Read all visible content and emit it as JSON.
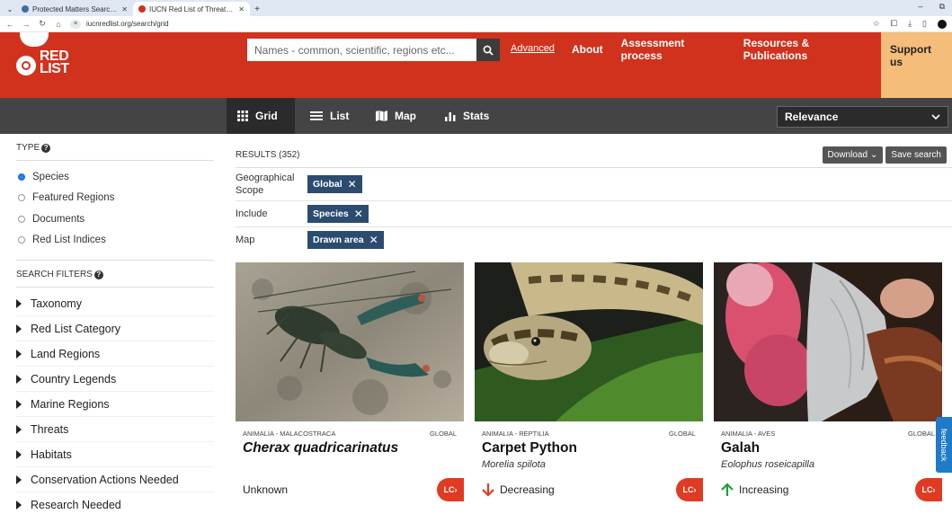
{
  "browser": {
    "tabs": [
      {
        "label": "Protected Matters Search Tool",
        "active": false,
        "favicon_color": "#3a6ea5"
      },
      {
        "label": "IUCN Red List of Threatened S",
        "active": true,
        "favicon_color": "#d0321d"
      }
    ],
    "url": "iucnredlist.org/search/grid"
  },
  "header": {
    "logo_text": "RED\nLIST",
    "search_placeholder": "Names - common, scientific, regions etc...",
    "advanced_link": "Advanced",
    "nav": [
      "About",
      "Assessment process",
      "Resources & Publications",
      "Support us"
    ]
  },
  "viewbar": {
    "tabs": [
      {
        "label": "Grid",
        "icon": "grid-icon",
        "active": true
      },
      {
        "label": "List",
        "icon": "list-icon",
        "active": false
      },
      {
        "label": "Map",
        "icon": "map-icon",
        "active": false
      },
      {
        "label": "Stats",
        "icon": "stats-icon",
        "active": false
      }
    ],
    "sort_value": "Relevance"
  },
  "sidebar": {
    "type_heading": "TYPE",
    "types": [
      {
        "label": "Species",
        "selected": true
      },
      {
        "label": "Featured Regions",
        "selected": false
      },
      {
        "label": "Documents",
        "selected": false
      },
      {
        "label": "Red List Indices",
        "selected": false
      }
    ],
    "filters_heading": "SEARCH FILTERS",
    "filters": [
      "Taxonomy",
      "Red List Category",
      "Land Regions",
      "Country Legends",
      "Marine Regions",
      "Threats",
      "Habitats",
      "Conservation Actions Needed",
      "Research Needed"
    ]
  },
  "results": {
    "count": "RESULTS (352)",
    "download": "Download",
    "save": "Save search",
    "filters": [
      {
        "label": "Geographical Scope",
        "chip": "Global"
      },
      {
        "label": "Include",
        "chip": "Species"
      },
      {
        "label": "Map",
        "chip": "Drawn area"
      }
    ]
  },
  "cards": [
    {
      "taxonomy": "ANIMALIA - MALACOSTRACA",
      "scope": "GLOBAL",
      "title": "Cherax quadricarinatus",
      "title_italic": true,
      "scientific": "",
      "trend": "Unknown",
      "trend_icon": "none",
      "category": "LC"
    },
    {
      "taxonomy": "ANIMALIA - REPTILIA",
      "scope": "GLOBAL",
      "title": "Carpet Python",
      "title_italic": false,
      "scientific": "Morelia spilota",
      "trend": "Decreasing",
      "trend_icon": "arrow-down-icon",
      "category": "LC"
    },
    {
      "taxonomy": "ANIMALIA - AVES",
      "scope": "GLOBAL",
      "title": "Galah",
      "title_italic": false,
      "scientific": "Eolophus roseicapilla",
      "trend": "Increasing",
      "trend_icon": "arrow-up-icon",
      "category": "LC"
    }
  ],
  "feedback_label": "feedback",
  "colors": {
    "brand_red": "#d0321d",
    "support_orange": "#f5bd7a",
    "chip_blue": "#2b4c6f",
    "lc_badge": "#e03b22",
    "decrease": "#e03b22",
    "increase": "#1e9e3a"
  }
}
